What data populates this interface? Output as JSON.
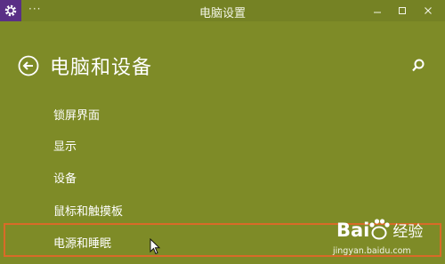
{
  "window": {
    "title": "电脑设置",
    "dots": "···"
  },
  "header": {
    "title": "电脑和设备"
  },
  "menu": {
    "items": [
      {
        "label": "锁屏界面"
      },
      {
        "label": "显示"
      },
      {
        "label": "设备"
      },
      {
        "label": "鼠标和触摸板"
      },
      {
        "label": "电源和睡眠"
      }
    ]
  },
  "watermark": {
    "brand_left": "Bai",
    "brand_right": "经验",
    "site": "jingyan.baidu.com"
  },
  "colors": {
    "accent_background": "#7e8b27",
    "titlebar": "#758224",
    "app_icon_bg": "#5a2f86",
    "highlight_border": "#d96a28"
  },
  "icons": {
    "app": "gear-icon",
    "back": "back-arrow-icon",
    "search": "search-icon",
    "minimize": "minimize-icon",
    "maximize": "maximize-icon",
    "close": "close-icon",
    "cursor": "mouse-cursor-icon",
    "watermark": "paw-icon"
  }
}
